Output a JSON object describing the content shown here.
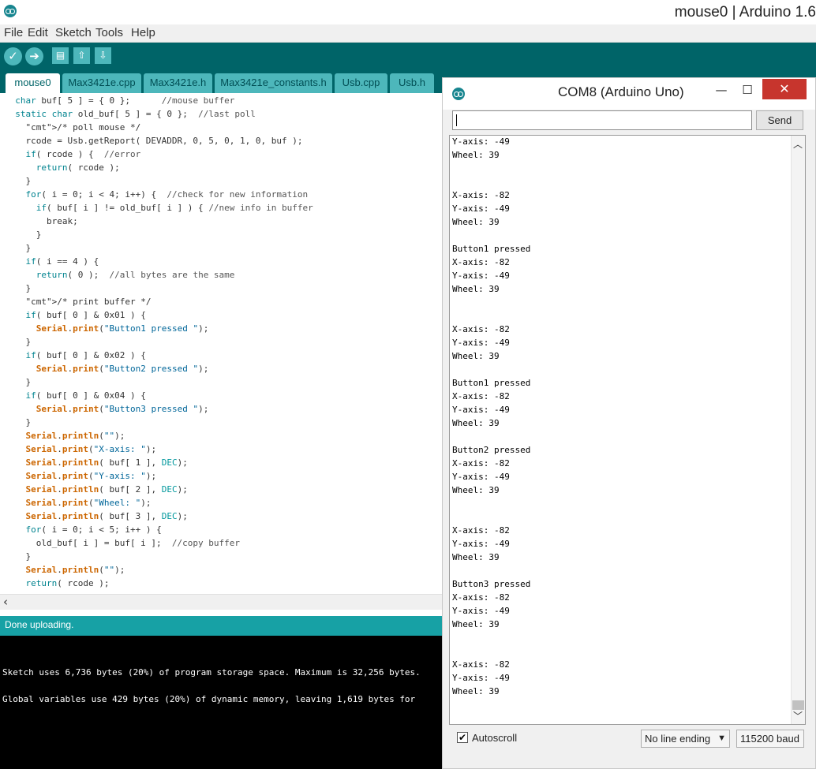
{
  "window": {
    "title": "mouse0 | Arduino 1.6"
  },
  "menu": [
    "File",
    "Edit",
    "Sketch",
    "Tools",
    "Help"
  ],
  "toolbar": {
    "verify_icon": "check-icon",
    "upload_icon": "arrow-right-icon",
    "new_icon": "new-file-icon",
    "open_icon": "open-arrow-up-icon",
    "save_icon": "save-arrow-down-icon"
  },
  "tabs": [
    "mouse0",
    "Max3421e.cpp",
    "Max3421e.h",
    "Max3421e_constants.h",
    "Usb.cpp",
    "Usb.h"
  ],
  "code_lines": [
    "  char buf[ 5 ] = { 0 };      //mouse buffer",
    "  static char old_buf[ 5 ] = { 0 };  //last poll",
    "    /* poll mouse */",
    "    rcode = Usb.getReport( DEVADDR, 0, 5, 0, 1, 0, buf );",
    "    if( rcode ) {  //error",
    "      return( rcode );",
    "    }",
    "    for( i = 0; i < 4; i++) {  //check for new information",
    "      if( buf[ i ] != old_buf[ i ] ) { //new info in buffer",
    "        break;",
    "      }",
    "    }",
    "    if( i == 4 ) {",
    "      return( 0 );  //all bytes are the same",
    "    }",
    "    /* print buffer */",
    "    if( buf[ 0 ] & 0x01 ) {",
    "      Serial.print(\"Button1 pressed \");",
    "    }",
    "    if( buf[ 0 ] & 0x02 ) {",
    "      Serial.print(\"Button2 pressed \");",
    "    }",
    "    if( buf[ 0 ] & 0x04 ) {",
    "      Serial.print(\"Button3 pressed \");",
    "    }",
    "    Serial.println(\"\");",
    "    Serial.print(\"X-axis: \");",
    "    Serial.println( buf[ 1 ], DEC);",
    "    Serial.print(\"Y-axis: \");",
    "    Serial.println( buf[ 2 ], DEC);",
    "    Serial.print(\"Wheel: \");",
    "    Serial.println( buf[ 3 ], DEC);",
    "    for( i = 0; i < 5; i++ ) {",
    "      old_buf[ i ] = buf[ i ];  //copy buffer",
    "    }",
    "    Serial.println(\"\");",
    "    return( rcode );"
  ],
  "status": {
    "text": "Done uploading."
  },
  "console_lines": [
    "",
    "",
    "Sketch uses 6,736 bytes (20%) of program storage space. Maximum is 32,256 bytes.",
    "",
    "Global variables use 429 bytes (20%) of dynamic memory, leaving 1,619 bytes for"
  ],
  "serial": {
    "title": "COM8 (Arduino Uno)",
    "send_label": "Send",
    "input_value": "",
    "output_lines": [
      "Y-axis: -49",
      "Wheel: 39",
      "",
      "",
      "X-axis: -82",
      "Y-axis: -49",
      "Wheel: 39",
      "",
      "Button1 pressed",
      "X-axis: -82",
      "Y-axis: -49",
      "Wheel: 39",
      "",
      "",
      "X-axis: -82",
      "Y-axis: -49",
      "Wheel: 39",
      "",
      "Button1 pressed",
      "X-axis: -82",
      "Y-axis: -49",
      "Wheel: 39",
      "",
      "Button2 pressed",
      "X-axis: -82",
      "Y-axis: -49",
      "Wheel: 39",
      "",
      "",
      "X-axis: -82",
      "Y-axis: -49",
      "Wheel: 39",
      "",
      "Button3 pressed",
      "X-axis: -82",
      "Y-axis: -49",
      "Wheel: 39",
      "",
      "",
      "X-axis: -82",
      "Y-axis: -49",
      "Wheel: 39"
    ],
    "autoscroll_label": "Autoscroll",
    "autoscroll_checked": true,
    "line_ending": "No line ending",
    "baud": "115200 baud"
  },
  "colors": {
    "toolbar": "#006468",
    "tab": "#4db7bb",
    "status": "#17a1a5",
    "close": "#c7352d"
  }
}
